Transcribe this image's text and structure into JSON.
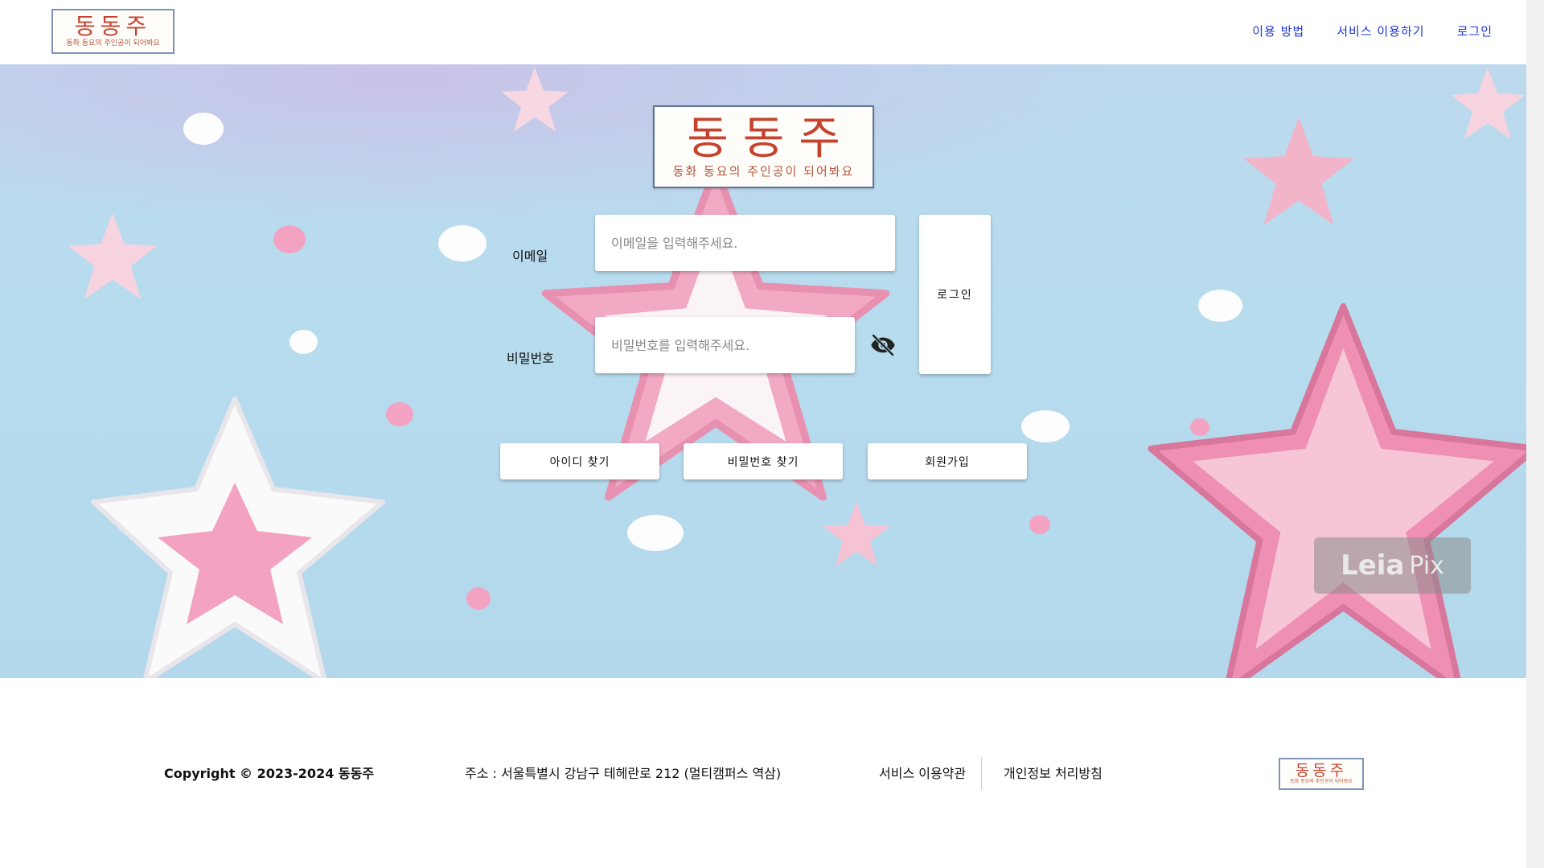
{
  "brand": {
    "logo_text": "동동주",
    "logo_subtitle": "동화 동요의 주인공이 되어봐요"
  },
  "nav": {
    "items": [
      "이용 방법",
      "서비스 이용하기",
      "로그인"
    ]
  },
  "login_form": {
    "email_label": "이메일",
    "email_placeholder": "이메일을 입력해주세요.",
    "password_label": "비밀번호",
    "password_placeholder": "비밀번호를 입력해주세요.",
    "login_button": "로그인",
    "find_id_button": "아이디 찾기",
    "find_password_button": "비밀번호 찾기",
    "signup_button": "회원가입"
  },
  "watermark": {
    "brand": "Leia",
    "suffix": "Pix"
  },
  "footer": {
    "copyright": "Copyright © 2023-2024 동동주",
    "address": "주소 : 서울특별시 강남구 테헤란로 212 (멀티캠퍼스 역삼)",
    "terms_link": "서비스 이용약관",
    "privacy_link": "개인정보 처리방침"
  },
  "icons": {
    "password_toggle": "eye-off-icon"
  },
  "colors": {
    "nav_link": "#1f36d6",
    "logo_red": "#c4432e",
    "hero_sky": "#b7dcee",
    "star_pink": "#f2a9c3"
  }
}
